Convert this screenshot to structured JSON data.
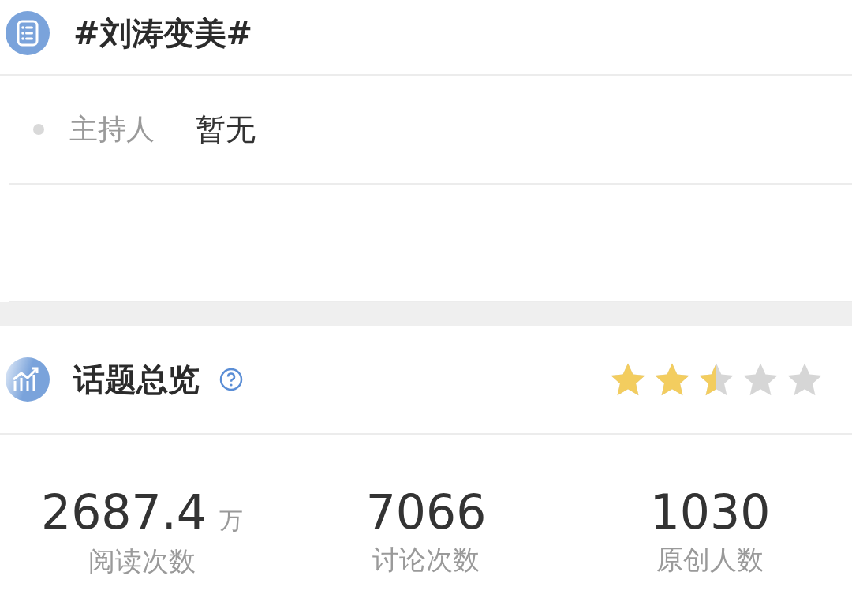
{
  "topic": {
    "title": "#刘涛变美#"
  },
  "host": {
    "label": "主持人",
    "value": "暂无"
  },
  "overview": {
    "title": "话题总览",
    "stars": 2.5
  },
  "stats": [
    {
      "value": "2687.4",
      "unit": "万",
      "label": "阅读次数"
    },
    {
      "value": "7066",
      "label": "讨论次数"
    },
    {
      "value": "1030",
      "label": "原创人数"
    }
  ]
}
